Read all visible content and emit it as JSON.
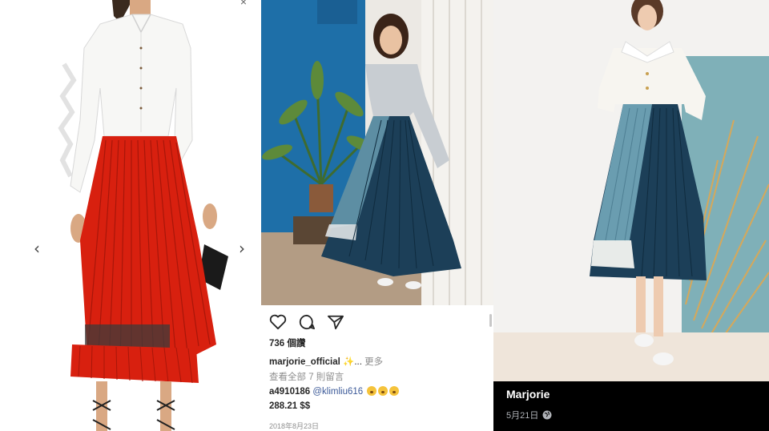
{
  "panel1": {
    "close_glyph": "×",
    "prev_arrow": "‹",
    "next_arrow": "›"
  },
  "panel2": {
    "likes": "736 個讚",
    "caption_user": "marjorie_official",
    "caption_rest": "✨... ",
    "caption_more": "更多",
    "view_comments": "查看全部 7 則留言",
    "comment1_user": "a4910186",
    "comment1_mention": "@klimliu616",
    "comment2": "288.21 $$",
    "date": "2018年8月23日",
    "icons": [
      "heart-icon",
      "comment-icon",
      "share-icon"
    ]
  },
  "panel3": {
    "name": "Marjorie",
    "date": "5月21日",
    "privacy_icon": "globe-icon"
  },
  "colors": {
    "skirt_red": "#d8200f",
    "skirt_teal": "#4a7f93",
    "skirt_navy": "#1c3f58",
    "wall_blue": "#1e6fa8"
  }
}
